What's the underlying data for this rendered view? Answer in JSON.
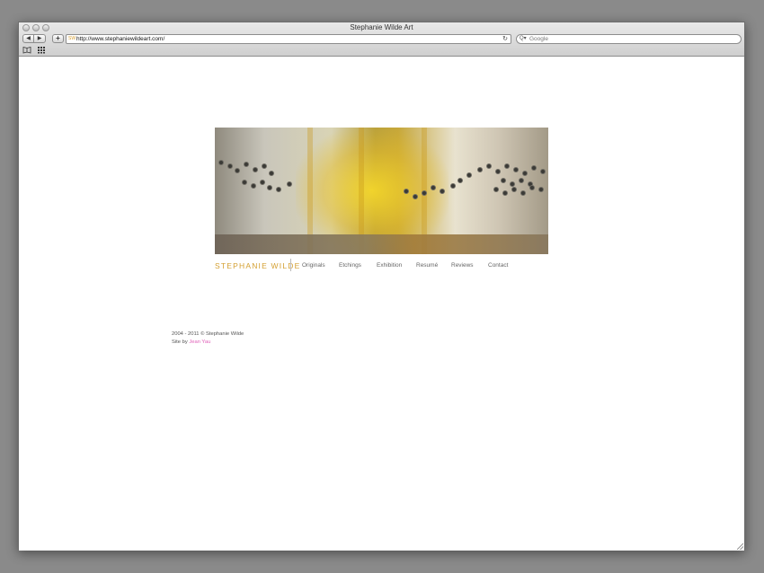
{
  "window": {
    "title": "Stephanie Wilde Art"
  },
  "toolbar": {
    "back_icon": "◀",
    "forward_icon": "▶",
    "add_icon": "+",
    "url": "http://www.stephaniewildeart.com/",
    "favicon": "SW",
    "reload_icon": "↻",
    "search_placeholder": "Google",
    "search_icon": "Q▾",
    "bookmarks_icon": "📖",
    "topsites_icon": "▦"
  },
  "site": {
    "brand": "STEPHANIE  WILDE",
    "nav": [
      "Originals",
      "Etchings",
      "Exhibition",
      "Resumé",
      "Reviews",
      "Contact"
    ],
    "footer": {
      "copyright": "2004 - 2011 © Stephanie Wilde",
      "credit_prefix": "Site by ",
      "credit_name": "Jean Yau"
    }
  },
  "colors": {
    "brand": "#d4a032",
    "credit_link": "#e05fb8"
  }
}
